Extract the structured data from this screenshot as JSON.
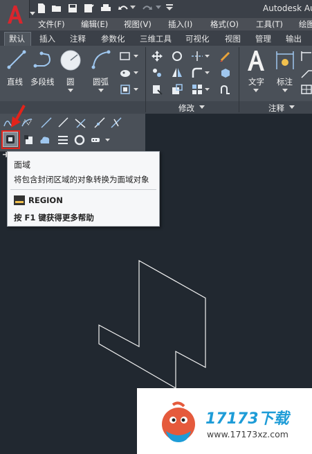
{
  "app_title": "Autodesk Au",
  "menu": [
    "文件(F)",
    "编辑(E)",
    "视图(V)",
    "插入(I)",
    "格式(O)",
    "工具(T)",
    "绘图"
  ],
  "tabs": [
    "默认",
    "插入",
    "注释",
    "参数化",
    "三维工具",
    "可视化",
    "视图",
    "管理",
    "输出"
  ],
  "ribbon": {
    "line": "直线",
    "polyline": "多段线",
    "circle": "圆",
    "arc": "圆弧",
    "modify_panel": "修改",
    "text": "文字",
    "dimension": "标注",
    "annotation_panel": "注释"
  },
  "tooltip": {
    "title": "面域",
    "description": "将包含封闭区域的对象转换为面域对象",
    "command": "REGION",
    "help": "按 F1 键获得更多帮助"
  },
  "watermark": {
    "brand": "17173下载",
    "url": "www.17173xz.com"
  },
  "colors": {
    "canvas": "#212830",
    "ribbon": "#4a5058",
    "highlight": "#e2231a",
    "brand": "#1e9cd7"
  }
}
